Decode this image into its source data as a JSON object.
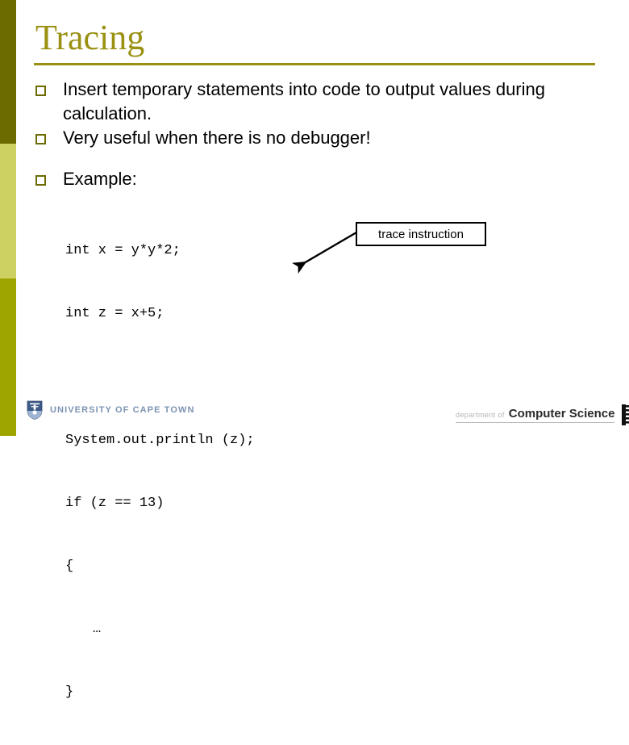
{
  "slide": {
    "title": "Tracing",
    "bullets": [
      {
        "text": "Insert temporary statements into code to output values during calculation."
      },
      {
        "text": "Very useful when there is no debugger!"
      }
    ],
    "example_bullet": "Example:",
    "code_lines": [
      {
        "text": "int x = y*y*2;",
        "indent": false
      },
      {
        "text": "int z = x+5;",
        "indent": false
      },
      {
        "text": "",
        "indent": false
      },
      {
        "text": "System.out.println (z);",
        "indent": false
      },
      {
        "text": "if (z == 13)",
        "indent": false
      },
      {
        "text": "{",
        "indent": false
      },
      {
        "text": "…",
        "indent": true
      },
      {
        "text": "}",
        "indent": false
      }
    ],
    "callout": {
      "label": "trace instruction"
    }
  },
  "footer": {
    "university": "UNIVERSITY OF CAPE TOWN",
    "department_small": "department of",
    "department_big": "Computer Science"
  },
  "colors": {
    "title": "#9a9113",
    "sidebar_top": "#6b6b00",
    "sidebar_mid": "#cdd162",
    "sidebar_bottom": "#9ea500",
    "bullet_mark": "#6b6b00",
    "body_text": "#000000",
    "uct_blue": "#7c93b4"
  }
}
